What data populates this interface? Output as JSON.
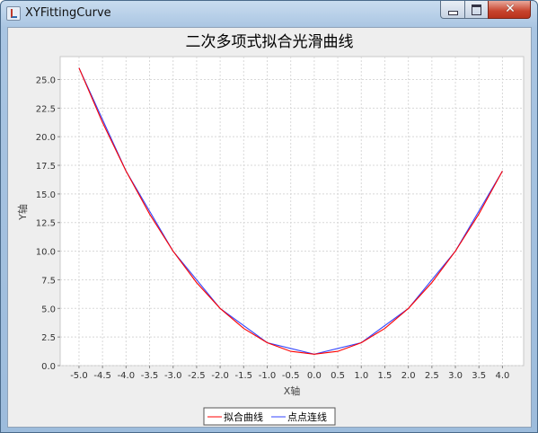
{
  "window": {
    "title": "XYFittingCurve",
    "controls": [
      "minimize",
      "maximize",
      "close"
    ]
  },
  "chart_data": {
    "type": "line",
    "title": "二次多项式拟合光滑曲线",
    "xlabel": "X轴",
    "ylabel": "Y轴",
    "xlim": [
      -5.4,
      4.45
    ],
    "ylim": [
      0,
      27
    ],
    "x_ticks": [
      -5.0,
      -4.5,
      -4.0,
      -3.5,
      -3.0,
      -2.5,
      -2.0,
      -1.5,
      -1.0,
      -0.5,
      0.0,
      0.5,
      1.0,
      1.5,
      2.0,
      2.5,
      3.0,
      3.5,
      4.0
    ],
    "y_ticks": [
      0.0,
      2.5,
      5.0,
      7.5,
      10.0,
      12.5,
      15.0,
      17.5,
      20.0,
      22.5,
      25.0
    ],
    "grid": true,
    "legend_position": "bottom",
    "series": [
      {
        "name": "拟合曲线",
        "color": "#ff0000",
        "x": [
          -5,
          -4.5,
          -4,
          -3.5,
          -3,
          -2.5,
          -2,
          -1.5,
          -1,
          -0.5,
          0,
          0.5,
          1,
          1.5,
          2,
          2.5,
          3,
          3.5,
          4
        ],
        "y": [
          26,
          21.25,
          17,
          13.25,
          10,
          7.25,
          5,
          3.25,
          2,
          1.25,
          1,
          1.25,
          2,
          3.25,
          5,
          7.25,
          10,
          13.25,
          17
        ]
      },
      {
        "name": "点点连线",
        "color": "#3344ff",
        "x": [
          -5,
          -4,
          -3,
          -2,
          -1,
          0,
          1,
          2,
          3,
          4
        ],
        "y": [
          26,
          17,
          10,
          5,
          2,
          1,
          2,
          5,
          10,
          17
        ]
      }
    ]
  }
}
